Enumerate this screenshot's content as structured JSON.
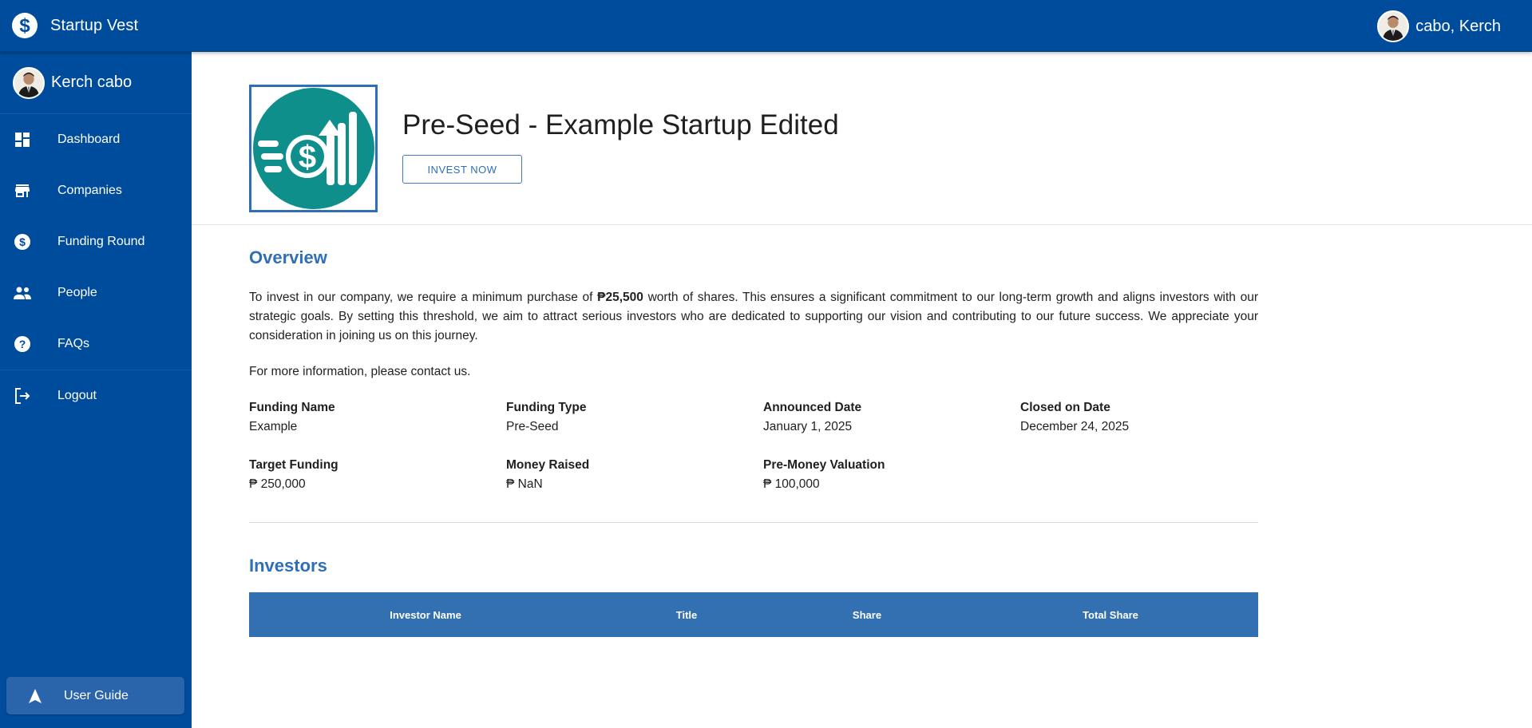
{
  "app": {
    "name": "Startup Vest",
    "user_display": "cabo, Kerch"
  },
  "sidebar": {
    "profile_name": "Kerch cabo",
    "items": [
      {
        "label": "Dashboard",
        "icon": "dashboard-icon"
      },
      {
        "label": "Companies",
        "icon": "store-icon"
      },
      {
        "label": "Funding Round",
        "icon": "dollar-circle-icon"
      },
      {
        "label": "People",
        "icon": "people-icon"
      },
      {
        "label": "FAQs",
        "icon": "help-circle-icon"
      },
      {
        "label": "Logout",
        "icon": "logout-icon"
      }
    ],
    "user_guide_label": "User Guide"
  },
  "hero": {
    "title": "Pre-Seed - Example Startup Edited",
    "invest_button": "INVEST NOW"
  },
  "overview": {
    "title": "Overview",
    "text_before": "To invest in our company, we require a minimum purchase of ",
    "min_amount": "₱25,500",
    "text_after": " worth of shares. This ensures a significant commitment to our long-term growth and aligns investors with our strategic goals. By setting this threshold, we aim to attract serious investors who are dedicated to supporting our vision and contributing to our future success. We appreciate your consideration in joining us on this journey.",
    "contact": "For more information, please contact us."
  },
  "fields": [
    {
      "label": "Funding Name",
      "value": "Example"
    },
    {
      "label": "Funding Type",
      "value": "Pre-Seed"
    },
    {
      "label": "Announced Date",
      "value": "January 1, 2025"
    },
    {
      "label": "Closed on Date",
      "value": "December 24, 2025"
    },
    {
      "label": "Target Funding",
      "value": "₱ 250,000"
    },
    {
      "label": "Money Raised",
      "value": "₱ NaN"
    },
    {
      "label": "Pre-Money Valuation",
      "value": "₱ 100,000"
    }
  ],
  "investors": {
    "title": "Investors",
    "columns": [
      "Investor Name",
      "Title",
      "Share",
      "Total Share"
    ]
  },
  "colors": {
    "primary": "#004c9c",
    "accent": "#2f6fb6",
    "table_header": "#3370b1",
    "logo_teal": "#0e8f8c"
  }
}
